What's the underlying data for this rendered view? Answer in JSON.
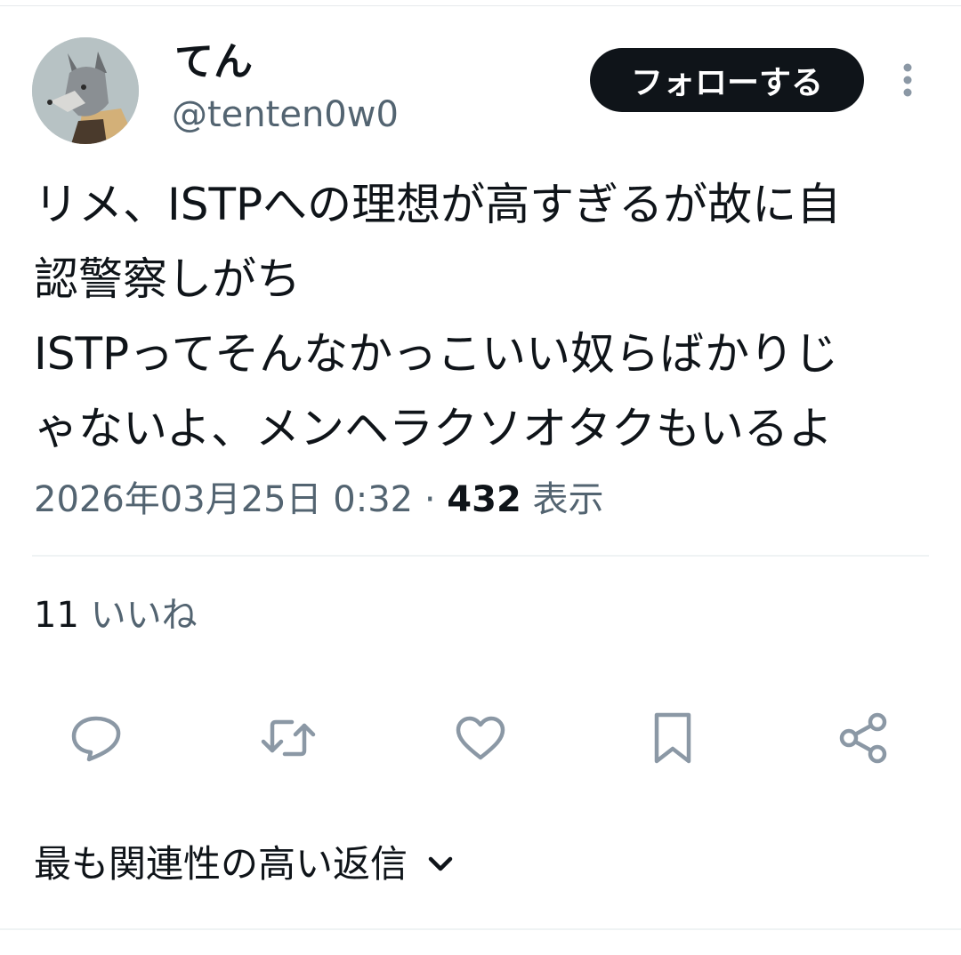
{
  "author": {
    "display_name": "てん",
    "handle": "@tenten0w0"
  },
  "follow_button_label": "フォローする",
  "tweet": {
    "lines": [
      "リメ、ISTPへの理想が高すぎるが故に自",
      "認警察しがち",
      "ISTPってそんなかっこいい奴らばかりじ",
      "ゃないよ、メンヘラクソオタクもいるよ"
    ],
    "timestamp": "2026年03月25日 0:32",
    "separator": "·",
    "views_count": "432",
    "views_label": "表示"
  },
  "likes": {
    "count": "11",
    "label": "いいね"
  },
  "actions": [
    {
      "name": "reply",
      "icon": "speech-bubble-icon"
    },
    {
      "name": "retweet",
      "icon": "retweet-arrows-icon"
    },
    {
      "name": "like",
      "icon": "heart-icon"
    },
    {
      "name": "bookmark",
      "icon": "bookmark-icon"
    },
    {
      "name": "share",
      "icon": "share-icon"
    }
  ],
  "replies_sort_label": "最も関連性の高い返信",
  "colors": {
    "text": "#0f1419",
    "secondary": "#536471",
    "icon": "#8b98a5",
    "button_bg": "#0f1419",
    "divider": "#eff3f4"
  }
}
